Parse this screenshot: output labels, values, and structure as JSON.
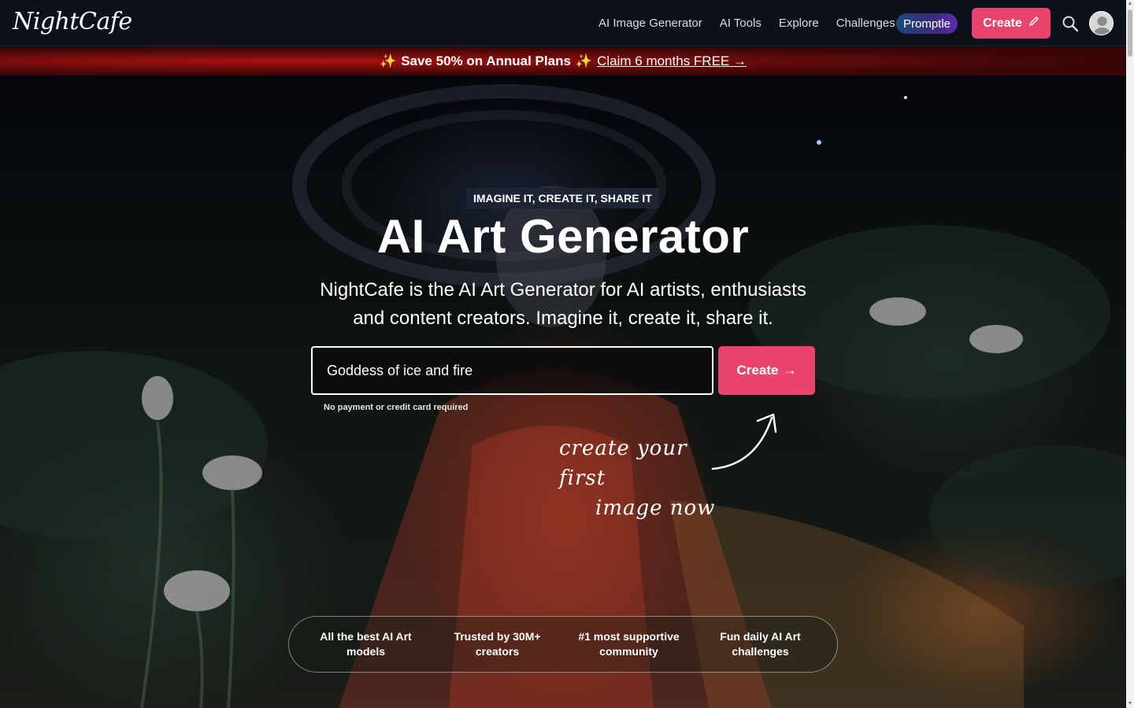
{
  "brand": {
    "logo_text": "NightCafe"
  },
  "nav": {
    "links": [
      "AI Image Generator",
      "AI Tools",
      "Explore",
      "Challenges"
    ],
    "promptle_label": "Promptle",
    "create_label": "Create",
    "icons": {
      "search": "search-icon",
      "avatar": "user-avatar",
      "pencil": "pencil-icon"
    }
  },
  "promo": {
    "sparkle_left": "✨",
    "headline": "Save 50% on Annual Plans",
    "sparkle_right": "✨",
    "link_text": "Claim 6 months FREE →"
  },
  "hero": {
    "tagline": "IMAGINE IT, CREATE IT, SHARE IT",
    "title": "AI Art Generator",
    "subtitle": "NightCafe is the AI Art Generator for AI artists, enthusiasts and content creators. Imagine it, create it, share it.",
    "prompt_value": "Goddess of ice and fire",
    "create_label": "Create",
    "create_arrow": "→",
    "no_payment": "No payment or credit card required",
    "handwritten_line1": "create your first",
    "handwritten_line2": "image now"
  },
  "features": [
    "All the best AI Art models",
    "Trusted by 30M+ creators",
    "#1 most supportive community",
    "Fun daily AI Art challenges"
  ],
  "colors": {
    "accent": "#e8446c",
    "nav_bg": "#0c111b",
    "promo_bg": "#6a0c0c",
    "tagline_bg": "#1e2434"
  }
}
